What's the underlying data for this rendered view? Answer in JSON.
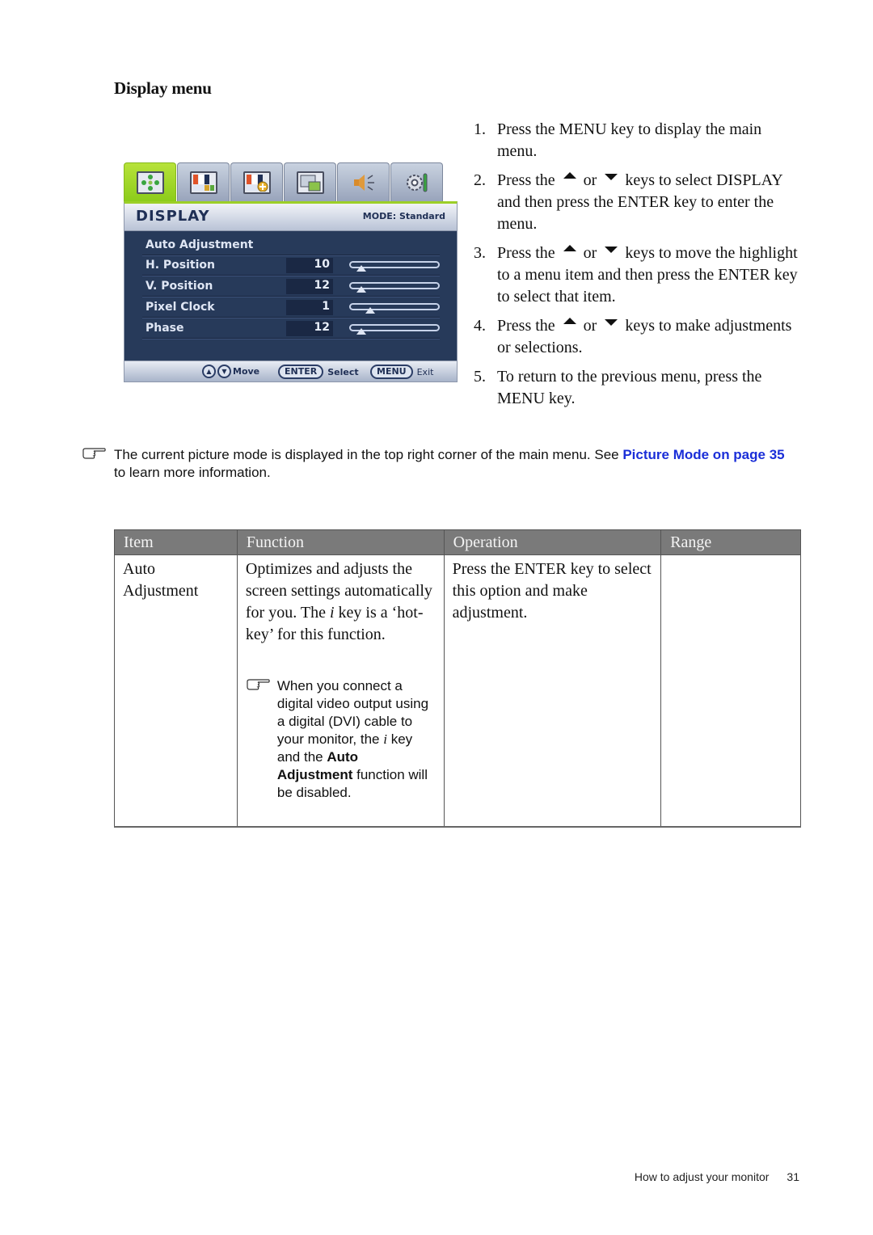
{
  "section_title": "Display menu",
  "osd": {
    "tabs": [
      {
        "icon": "display-icon",
        "active": true
      },
      {
        "icon": "picture-icon",
        "active": false
      },
      {
        "icon": "picture-advanced-icon",
        "active": false
      },
      {
        "icon": "pip-icon",
        "active": false
      },
      {
        "icon": "audio-icon",
        "active": false
      },
      {
        "icon": "system-settings-icon",
        "active": false
      }
    ],
    "title": "DISPLAY",
    "mode": "MODE: Standard",
    "items": [
      {
        "label": "Auto Adjustment"
      },
      {
        "label": "H. Position",
        "value": "10",
        "slider_fraction": 0.12
      },
      {
        "label": "V. Position",
        "value": "12",
        "slider_fraction": 0.12
      },
      {
        "label": "Pixel Clock",
        "value": "1",
        "slider_fraction": 0.22
      },
      {
        "label": "Phase",
        "value": "12",
        "slider_fraction": 0.12
      }
    ],
    "footer": {
      "move": "Move",
      "enter_key": "ENTER",
      "select": "Select",
      "menu_key": "MENU",
      "exit": "Exit"
    }
  },
  "steps": [
    {
      "num": "1.",
      "parts": [
        "Press the MENU key to display the main menu."
      ]
    },
    {
      "num": "2.",
      "before": "Press the",
      "or": "or",
      "after": "keys to select DISPLAY and then press the ENTER key to enter the menu."
    },
    {
      "num": "3.",
      "before": "Press the",
      "or": "or",
      "after": "keys to move the highlight to a menu item and then press the ENTER key to select that item."
    },
    {
      "num": "4.",
      "before": "Press the",
      "or": "or",
      "after": "keys to make adjustments or selections."
    },
    {
      "num": "5.",
      "parts": [
        "To return to the previous menu, press the MENU key."
      ]
    }
  ],
  "note": {
    "text": "The current picture mode is displayed in the top right corner of the main menu. See ",
    "link": "Picture Mode on page 35",
    "tail": " to learn more information."
  },
  "table": {
    "headers": [
      "Item",
      "Function",
      "Operation",
      "Range"
    ],
    "rows": [
      {
        "item": "Auto Adjustment",
        "function_pre": "Optimizes and adjusts the screen settings automatically for you. The ",
        "function_i": "i",
        "function_post": " key is a ‘hot-key’ for this function.",
        "note_pre": "When you connect a digital video output using a digital (DVI) cable to your monitor, the ",
        "note_i": "i",
        "note_mid": " key and the ",
        "note_bold": "Auto Adjustment",
        "note_post": " function will be disabled.",
        "operation": "Press the ENTER key to select this option and make adjustment.",
        "range": ""
      }
    ]
  },
  "footer": {
    "chapter": "How to adjust your monitor",
    "page": "31"
  }
}
